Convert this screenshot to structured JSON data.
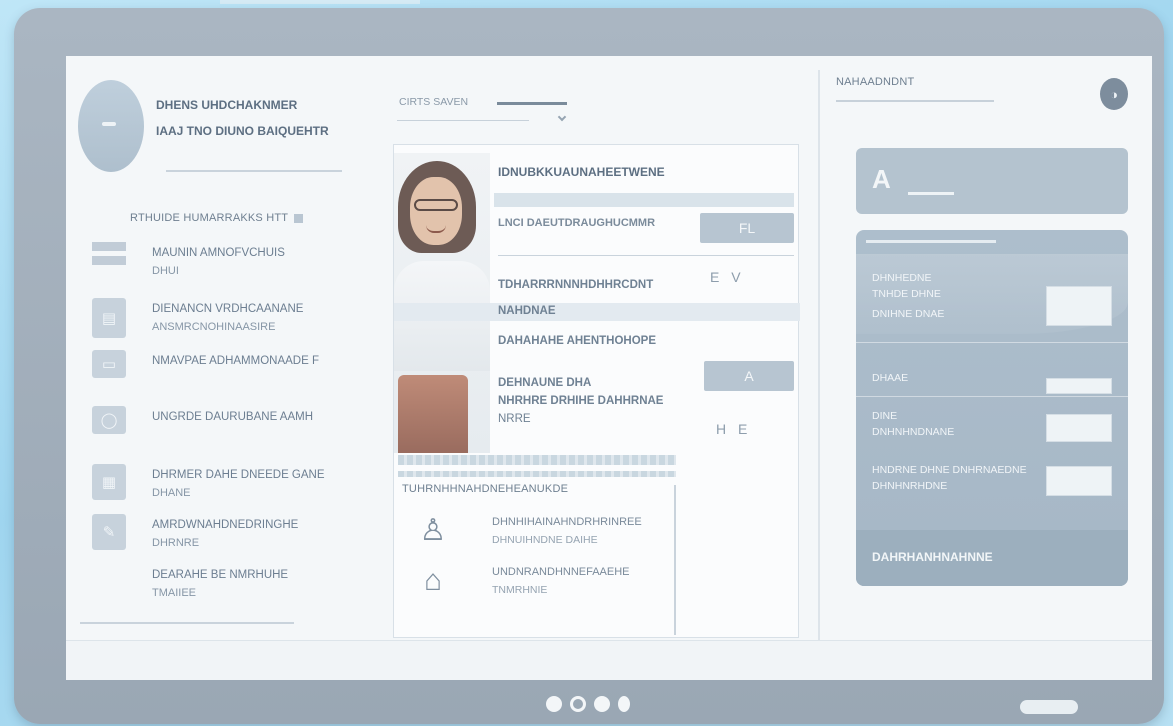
{
  "profile": {
    "name": "DHENS UHDCHAKNMER",
    "subtitle": "IAAJ TNO DIUNO BAIQUEHTR"
  },
  "left": {
    "section_title": "RTHUIDE HUMARRAKKS HTT",
    "nav": [
      {
        "icon": "list-icon",
        "label": "MAUNIN AMNOFVCHUIS",
        "sub": "DHUI"
      },
      {
        "icon": "document-icon",
        "label": "DIENANCN VRDHCAANANE",
        "sub": "ANSMRCNOHINAASIRE"
      },
      {
        "icon": "monitor-icon",
        "label": "NMAVPAE ADHAMMONAADE F",
        "sub": ""
      },
      {
        "icon": "chat-icon",
        "label": "UNGRDE DAURUBANE AAMH",
        "sub": ""
      },
      {
        "icon": "calendar-icon",
        "label": "DHRMER DAHE DNEEDE GANE",
        "sub": "DHANE"
      },
      {
        "icon": "edit-icon",
        "label": "AMRDWNAHDNEDRINGHE",
        "sub": "DHRNRE"
      },
      {
        "icon": "",
        "label": "DEARAHE BE NMRHUHE",
        "sub": "TMAIIEE"
      }
    ]
  },
  "middle": {
    "search_label": "CIRTS SAVEN",
    "card": {
      "title": "IDNUBKKUAUNAHEETWENE",
      "line1": "LNCI DAEUTDRAUGHUCMMR",
      "pill1": "FL",
      "glyphs1": "E V",
      "line2": "TDHARRRNNNHDHHRCDNT",
      "line3": "NAHDNAE",
      "line4": "DAHAHAHE AHENTHOHOPE",
      "line5": "DEHNAUNE DHA",
      "line6": "NHRHRE DRHIHE DAHHRNAE",
      "line7": "NRRE",
      "pill2": "A",
      "glyphs2": "H E",
      "list_header": "TUHRNHHNAHDNEHEANUKDE",
      "list": [
        {
          "icon": "person-icon",
          "l1": "DHNHIHAINAHNDRHRINREE",
          "l2": "DHNUIHNDNE DAIHE"
        },
        {
          "icon": "person-outline-icon",
          "l1": "UNDNRANDHNNEFAAEHE",
          "l2": "TNMRHNIE"
        }
      ]
    }
  },
  "right": {
    "title": "NAHAADNDNT",
    "user_icon": "user-icon",
    "card_glyph": "A",
    "panel": {
      "rows": [
        {
          "l1": "DHNHEDNE",
          "l2": "TNHDE DHNE"
        },
        {
          "l1": "DNIHNE DNAE",
          "l2": ""
        },
        {
          "l1": "DHAAE",
          "l2": ""
        },
        {
          "l1": "DINE",
          "l2": "DNHNHNDNANE"
        },
        {
          "l1": "HNDRNE DHNE DNHRNAEDNE",
          "l2": "DHNHNRHDNE"
        }
      ],
      "footer": "DAHRHANHNAHNNE"
    }
  },
  "colors": {
    "accent_panel": "#adbecc",
    "page_bg": "#bfe6f7"
  }
}
